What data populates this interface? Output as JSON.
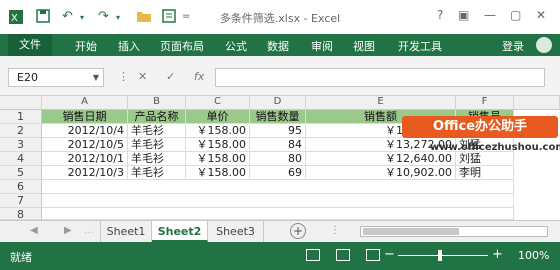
{
  "titlebar": {
    "qat": [
      "excel-logo-icon",
      "save-icon",
      "undo-icon",
      "redo-icon",
      "open-icon",
      "customize-icon"
    ],
    "title": "多条件筛选.xlsx - Excel",
    "help": "?",
    "ribbon_display": "▣",
    "minimize": "—",
    "restore": "▢",
    "close": "✕"
  },
  "ribbon": {
    "tabs": [
      "文件",
      "开始",
      "插入",
      "页面布局",
      "公式",
      "数据",
      "审阅",
      "视图",
      "开发工具"
    ],
    "login": "登录"
  },
  "formula_bar": {
    "name_box": "E20",
    "cancel": "✕",
    "enter": "✓",
    "fx": "fx",
    "value": ""
  },
  "grid": {
    "columns": [
      "A",
      "B",
      "C",
      "D",
      "E",
      "F"
    ],
    "rows": [
      "1",
      "2",
      "3",
      "4",
      "5",
      "6",
      "7",
      "8"
    ],
    "header": [
      "销售日期",
      "产品名称",
      "单价",
      "销售数量",
      "销售额",
      "销售员"
    ],
    "data": [
      [
        "2012/10/4",
        "羊毛衫",
        "￥158.00",
        "95",
        "￥15,010.00",
        "刘"
      ],
      [
        "2012/10/5",
        "羊毛衫",
        "￥158.00",
        "84",
        "￥13,272.00",
        "刘猛"
      ],
      [
        "2012/10/1",
        "羊毛衫",
        "￥158.00",
        "80",
        "￥12,640.00",
        "刘猛"
      ],
      [
        "2012/10/3",
        "羊毛衫",
        "￥158.00",
        "69",
        "￥10,902.00",
        "李明"
      ]
    ],
    "header_color": "#9bc88b"
  },
  "watermark": {
    "brand": "Office办公助手",
    "url": "www.officezhushou.com"
  },
  "sheets": {
    "tabs": [
      "Sheet1",
      "Sheet2",
      "Sheet3"
    ],
    "active": "Sheet2"
  },
  "status": {
    "ready": "就绪",
    "zoom_minus": "−",
    "zoom_plus": "+",
    "zoom": "100%"
  },
  "colors": {
    "accent": "#217346",
    "watermark": "#e85a1f"
  }
}
